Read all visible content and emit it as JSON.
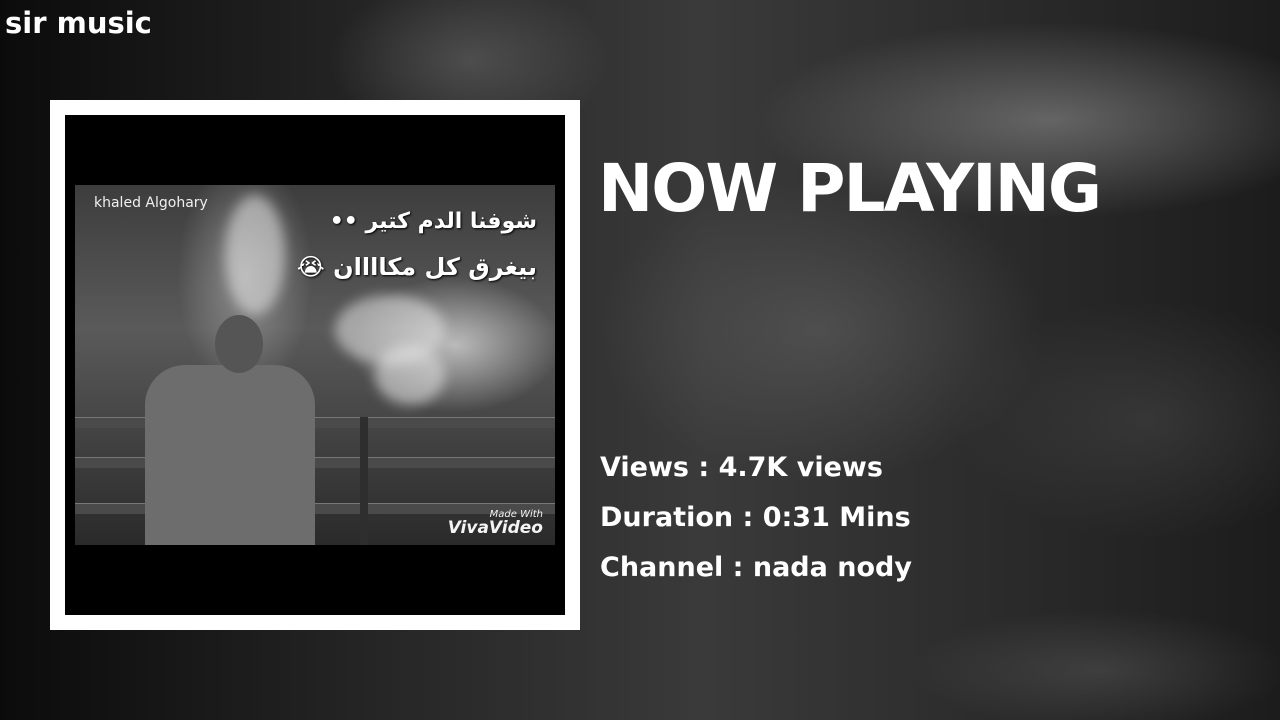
{
  "brand": {
    "title": "sir music"
  },
  "album_art": {
    "credit": "khaled Algohary",
    "arabic_line_1": "شوفنا الدم كتير ••",
    "arabic_line_2": "بيغرق كل مكاااان 😭",
    "watermark_small": "Made With",
    "watermark_big": "VivaVideo"
  },
  "heading": "NOW PLAYING",
  "meta": {
    "views": "Views : 4.7K views",
    "duration": "Duration : 0:31 Mins",
    "channel": "Channel : nada nody"
  },
  "colors": {
    "frame": "#ffffff",
    "text": "#ffffff",
    "background": "#2a2a2a"
  }
}
